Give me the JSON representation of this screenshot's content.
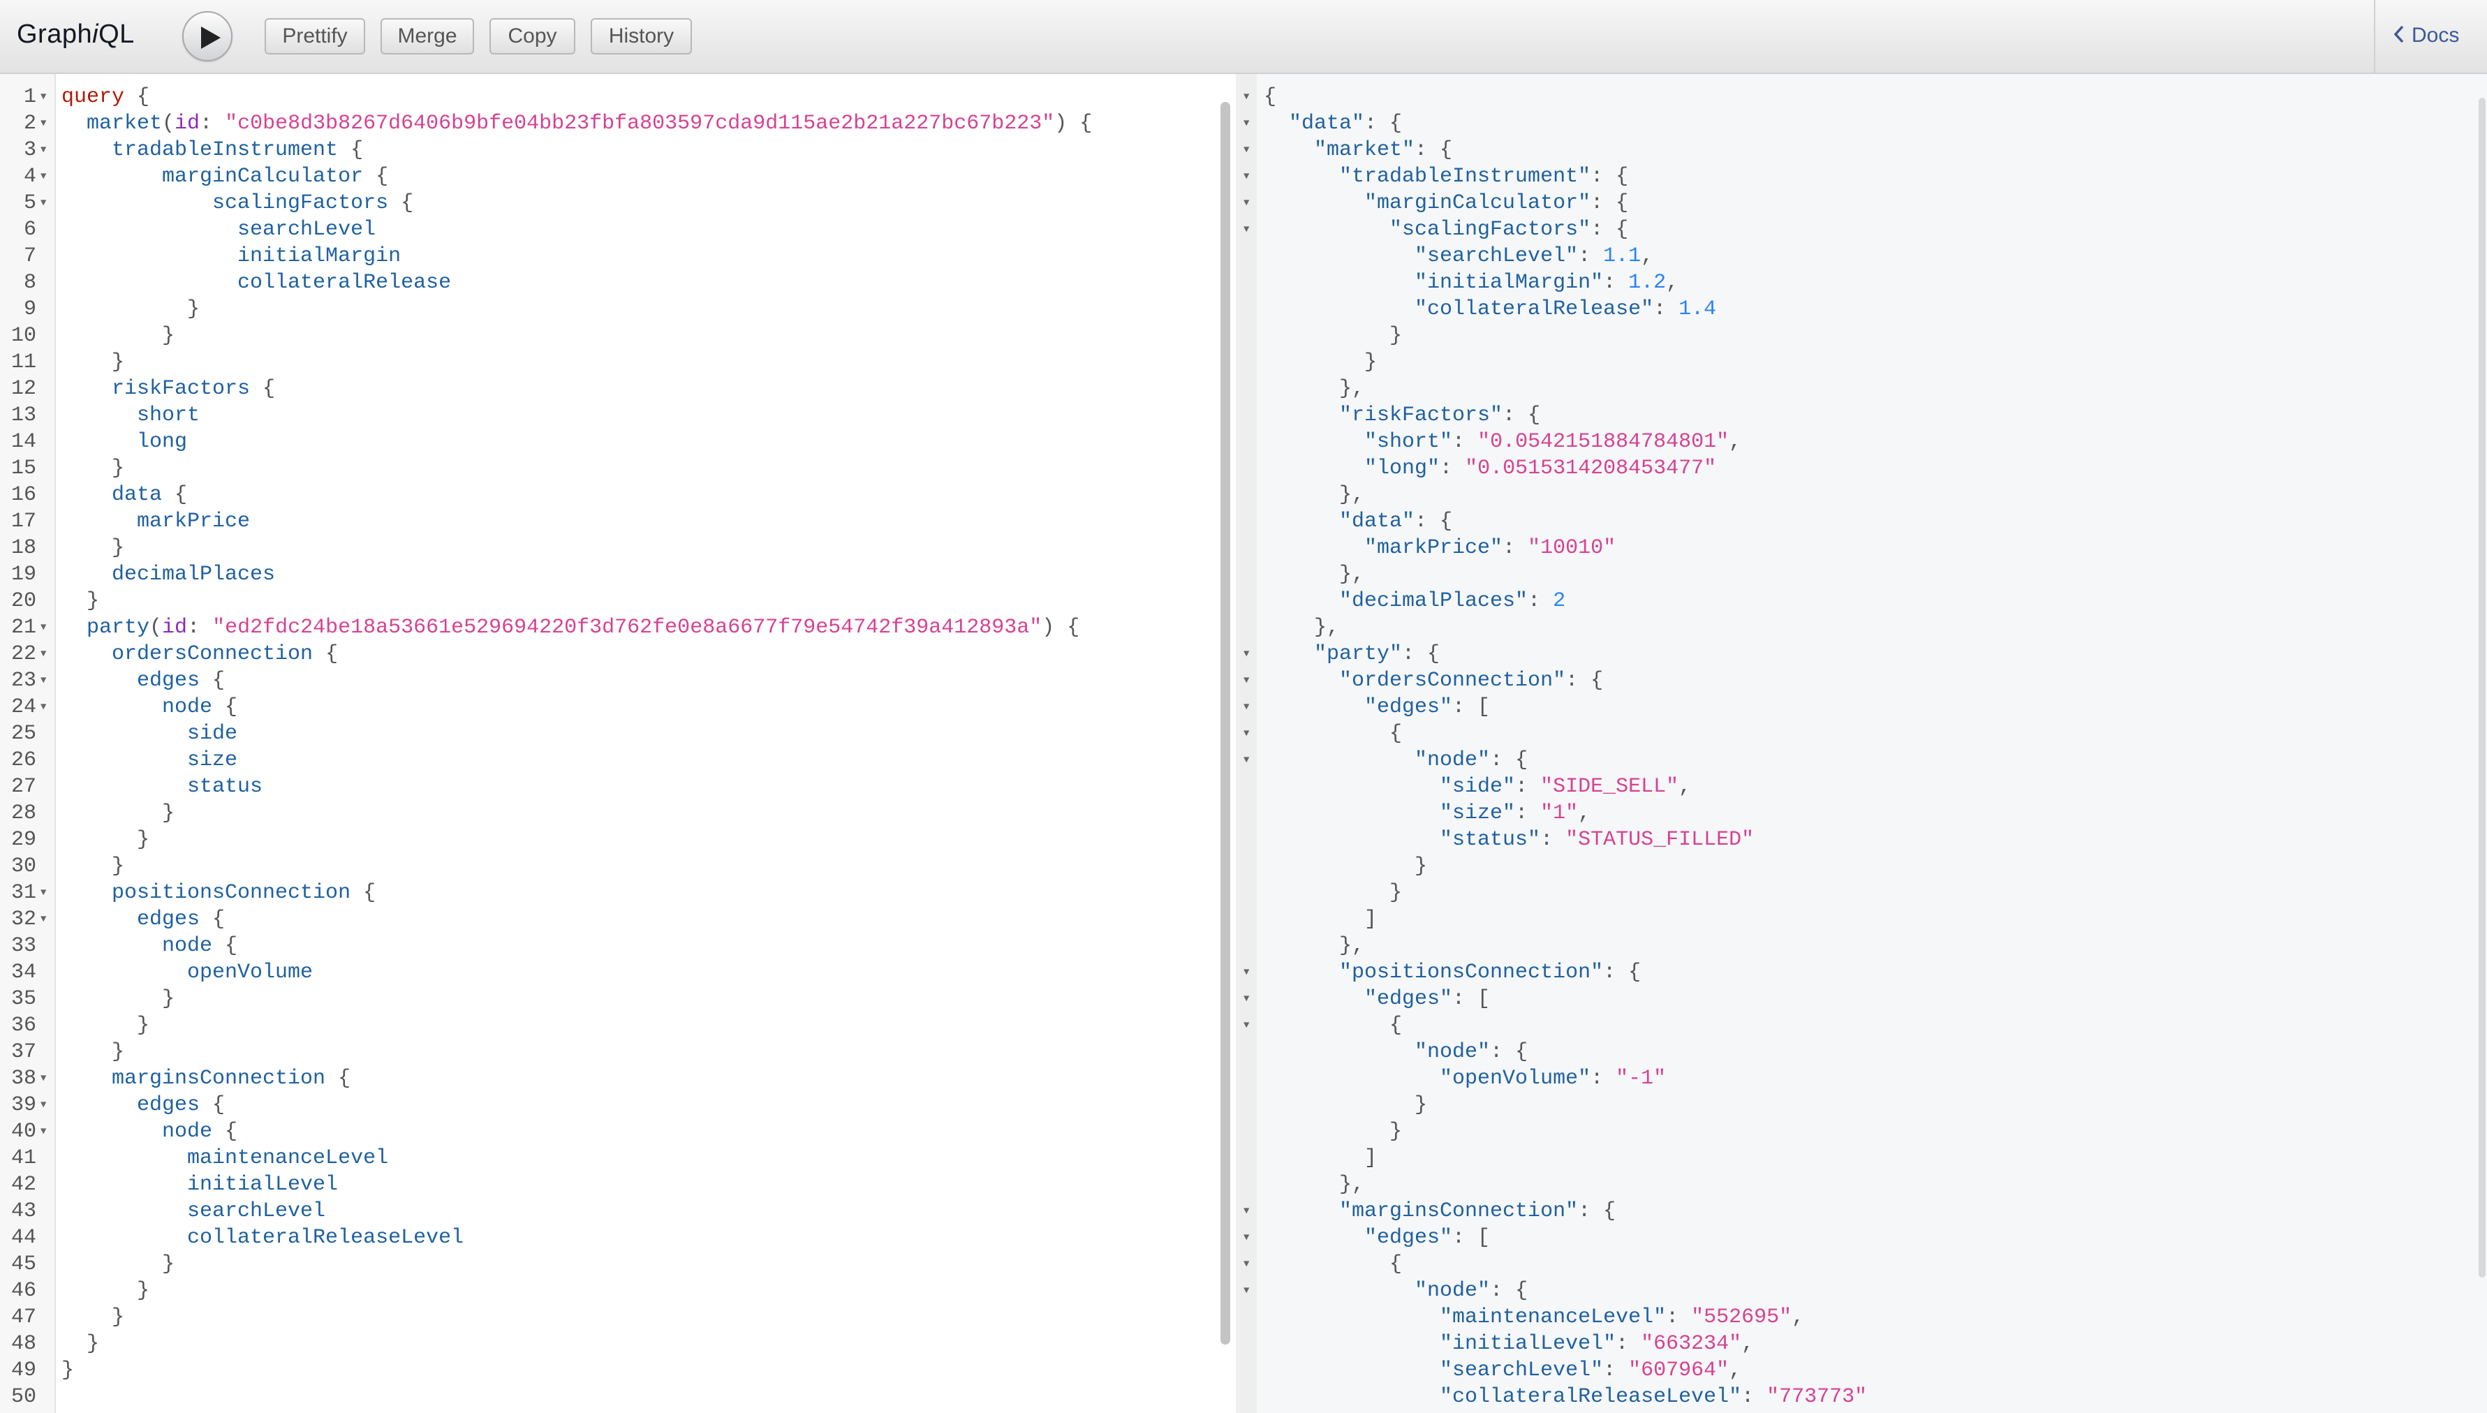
{
  "toolbar": {
    "logo_a": "Graph",
    "logo_b": "i",
    "logo_c": "QL",
    "prettify": "Prettify",
    "merge": "Merge",
    "copy": "Copy",
    "history": "History",
    "docs": "Docs"
  },
  "query_lines": [
    [
      [
        "kw",
        "query"
      ],
      [
        "punct",
        " {"
      ]
    ],
    [
      [
        "prop",
        "  market"
      ],
      [
        "punct",
        "("
      ],
      [
        "attr",
        "id"
      ],
      [
        "punct",
        ": "
      ],
      [
        "str",
        "\"c0be8d3b8267d6406b9bfe04bb23fbfa803597cda9d115ae2b21a227bc67b223\""
      ],
      [
        "punct",
        ") {"
      ]
    ],
    [
      [
        "prop",
        "    tradableInstrument"
      ],
      [
        "punct",
        " {"
      ]
    ],
    [
      [
        "prop",
        "        marginCalculator"
      ],
      [
        "punct",
        " {"
      ]
    ],
    [
      [
        "prop",
        "            scalingFactors"
      ],
      [
        "punct",
        " {"
      ]
    ],
    [
      [
        "prop",
        "              searchLevel"
      ]
    ],
    [
      [
        "prop",
        "              initialMargin"
      ]
    ],
    [
      [
        "prop",
        "              collateralRelease"
      ]
    ],
    [
      [
        "punct",
        "          }"
      ]
    ],
    [
      [
        "punct",
        "        }"
      ]
    ],
    [
      [
        "punct",
        "    }"
      ]
    ],
    [
      [
        "prop",
        "    riskFactors"
      ],
      [
        "punct",
        " {"
      ]
    ],
    [
      [
        "prop",
        "      short"
      ]
    ],
    [
      [
        "prop",
        "      long"
      ]
    ],
    [
      [
        "punct",
        "    }"
      ]
    ],
    [
      [
        "prop",
        "    data"
      ],
      [
        "punct",
        " {"
      ]
    ],
    [
      [
        "prop",
        "      markPrice"
      ]
    ],
    [
      [
        "punct",
        "    }"
      ]
    ],
    [
      [
        "prop",
        "    decimalPlaces"
      ]
    ],
    [
      [
        "punct",
        "  }"
      ]
    ],
    [
      [
        "prop",
        "  party"
      ],
      [
        "punct",
        "("
      ],
      [
        "attr",
        "id"
      ],
      [
        "punct",
        ": "
      ],
      [
        "str",
        "\"ed2fdc24be18a53661e529694220f3d762fe0e8a6677f79e54742f39a412893a\""
      ],
      [
        "punct",
        ") {"
      ]
    ],
    [
      [
        "prop",
        "    ordersConnection"
      ],
      [
        "punct",
        " {"
      ]
    ],
    [
      [
        "prop",
        "      edges"
      ],
      [
        "punct",
        " {"
      ]
    ],
    [
      [
        "prop",
        "        node"
      ],
      [
        "punct",
        " {"
      ]
    ],
    [
      [
        "prop",
        "          side"
      ]
    ],
    [
      [
        "prop",
        "          size"
      ]
    ],
    [
      [
        "prop",
        "          status"
      ]
    ],
    [
      [
        "punct",
        "        }"
      ]
    ],
    [
      [
        "punct",
        "      }"
      ]
    ],
    [
      [
        "punct",
        "    }"
      ]
    ],
    [
      [
        "prop",
        "    positionsConnection"
      ],
      [
        "punct",
        " {"
      ]
    ],
    [
      [
        "prop",
        "      edges"
      ],
      [
        "punct",
        " {"
      ]
    ],
    [
      [
        "prop",
        "        node"
      ],
      [
        "punct",
        " {"
      ]
    ],
    [
      [
        "prop",
        "          openVolume"
      ]
    ],
    [
      [
        "punct",
        "        }"
      ]
    ],
    [
      [
        "punct",
        "      }"
      ]
    ],
    [
      [
        "punct",
        "    }"
      ]
    ],
    [
      [
        "prop",
        "    marginsConnection"
      ],
      [
        "punct",
        " {"
      ]
    ],
    [
      [
        "prop",
        "      edges"
      ],
      [
        "punct",
        " {"
      ]
    ],
    [
      [
        "prop",
        "        node"
      ],
      [
        "punct",
        " {"
      ]
    ],
    [
      [
        "prop",
        "          maintenanceLevel"
      ]
    ],
    [
      [
        "prop",
        "          initialLevel"
      ]
    ],
    [
      [
        "prop",
        "          searchLevel"
      ]
    ],
    [
      [
        "prop",
        "          collateralReleaseLevel"
      ]
    ],
    [
      [
        "punct",
        "        }"
      ]
    ],
    [
      [
        "punct",
        "      }"
      ]
    ],
    [
      [
        "punct",
        "    }"
      ]
    ],
    [
      [
        "punct",
        "  }"
      ]
    ],
    [
      [
        "punct",
        "}"
      ]
    ],
    []
  ],
  "query_folds": [
    1,
    2,
    3,
    4,
    5,
    21,
    22,
    23,
    24,
    31,
    32,
    38,
    39,
    40
  ],
  "result_lines": [
    [
      [
        "punct",
        "{"
      ]
    ],
    [
      [
        "jkey",
        "  \"data\""
      ],
      [
        "punct",
        ": {"
      ]
    ],
    [
      [
        "jkey",
        "    \"market\""
      ],
      [
        "punct",
        ": {"
      ]
    ],
    [
      [
        "jkey",
        "      \"tradableInstrument\""
      ],
      [
        "punct",
        ": {"
      ]
    ],
    [
      [
        "jkey",
        "        \"marginCalculator\""
      ],
      [
        "punct",
        ": {"
      ]
    ],
    [
      [
        "jkey",
        "          \"scalingFactors\""
      ],
      [
        "punct",
        ": {"
      ]
    ],
    [
      [
        "jkey",
        "            \"searchLevel\""
      ],
      [
        "punct",
        ": "
      ],
      [
        "num",
        "1.1"
      ],
      [
        "punct",
        ","
      ]
    ],
    [
      [
        "jkey",
        "            \"initialMargin\""
      ],
      [
        "punct",
        ": "
      ],
      [
        "num",
        "1.2"
      ],
      [
        "punct",
        ","
      ]
    ],
    [
      [
        "jkey",
        "            \"collateralRelease\""
      ],
      [
        "punct",
        ": "
      ],
      [
        "num",
        "1.4"
      ]
    ],
    [
      [
        "punct",
        "          }"
      ]
    ],
    [
      [
        "punct",
        "        }"
      ]
    ],
    [
      [
        "punct",
        "      },"
      ]
    ],
    [
      [
        "jkey",
        "      \"riskFactors\""
      ],
      [
        "punct",
        ": {"
      ]
    ],
    [
      [
        "jkey",
        "        \"short\""
      ],
      [
        "punct",
        ": "
      ],
      [
        "str",
        "\"0.0542151884784801\""
      ],
      [
        "punct",
        ","
      ]
    ],
    [
      [
        "jkey",
        "        \"long\""
      ],
      [
        "punct",
        ": "
      ],
      [
        "str",
        "\"0.0515314208453477\""
      ]
    ],
    [
      [
        "punct",
        "      },"
      ]
    ],
    [
      [
        "jkey",
        "      \"data\""
      ],
      [
        "punct",
        ": {"
      ]
    ],
    [
      [
        "jkey",
        "        \"markPrice\""
      ],
      [
        "punct",
        ": "
      ],
      [
        "str",
        "\"10010\""
      ]
    ],
    [
      [
        "punct",
        "      },"
      ]
    ],
    [
      [
        "jkey",
        "      \"decimalPlaces\""
      ],
      [
        "punct",
        ": "
      ],
      [
        "num",
        "2"
      ]
    ],
    [
      [
        "punct",
        "    },"
      ]
    ],
    [
      [
        "jkey",
        "    \"party\""
      ],
      [
        "punct",
        ": {"
      ]
    ],
    [
      [
        "jkey",
        "      \"ordersConnection\""
      ],
      [
        "punct",
        ": {"
      ]
    ],
    [
      [
        "jkey",
        "        \"edges\""
      ],
      [
        "punct",
        ": ["
      ]
    ],
    [
      [
        "punct",
        "          {"
      ]
    ],
    [
      [
        "jkey",
        "            \"node\""
      ],
      [
        "punct",
        ": {"
      ]
    ],
    [
      [
        "jkey",
        "              \"side\""
      ],
      [
        "punct",
        ": "
      ],
      [
        "str",
        "\"SIDE_SELL\""
      ],
      [
        "punct",
        ","
      ]
    ],
    [
      [
        "jkey",
        "              \"size\""
      ],
      [
        "punct",
        ": "
      ],
      [
        "str",
        "\"1\""
      ],
      [
        "punct",
        ","
      ]
    ],
    [
      [
        "jkey",
        "              \"status\""
      ],
      [
        "punct",
        ": "
      ],
      [
        "str",
        "\"STATUS_FILLED\""
      ]
    ],
    [
      [
        "punct",
        "            }"
      ]
    ],
    [
      [
        "punct",
        "          }"
      ]
    ],
    [
      [
        "punct",
        "        ]"
      ]
    ],
    [
      [
        "punct",
        "      },"
      ]
    ],
    [
      [
        "jkey",
        "      \"positionsConnection\""
      ],
      [
        "punct",
        ": {"
      ]
    ],
    [
      [
        "jkey",
        "        \"edges\""
      ],
      [
        "punct",
        ": ["
      ]
    ],
    [
      [
        "punct",
        "          {"
      ]
    ],
    [
      [
        "jkey",
        "            \"node\""
      ],
      [
        "punct",
        ": {"
      ]
    ],
    [
      [
        "jkey",
        "              \"openVolume\""
      ],
      [
        "punct",
        ": "
      ],
      [
        "str",
        "\"-1\""
      ]
    ],
    [
      [
        "punct",
        "            }"
      ]
    ],
    [
      [
        "punct",
        "          }"
      ]
    ],
    [
      [
        "punct",
        "        ]"
      ]
    ],
    [
      [
        "punct",
        "      },"
      ]
    ],
    [
      [
        "jkey",
        "      \"marginsConnection\""
      ],
      [
        "punct",
        ": {"
      ]
    ],
    [
      [
        "jkey",
        "        \"edges\""
      ],
      [
        "punct",
        ": ["
      ]
    ],
    [
      [
        "punct",
        "          {"
      ]
    ],
    [
      [
        "jkey",
        "            \"node\""
      ],
      [
        "punct",
        ": {"
      ]
    ],
    [
      [
        "jkey",
        "              \"maintenanceLevel\""
      ],
      [
        "punct",
        ": "
      ],
      [
        "str",
        "\"552695\""
      ],
      [
        "punct",
        ","
      ]
    ],
    [
      [
        "jkey",
        "              \"initialLevel\""
      ],
      [
        "punct",
        ": "
      ],
      [
        "str",
        "\"663234\""
      ],
      [
        "punct",
        ","
      ]
    ],
    [
      [
        "jkey",
        "              \"searchLevel\""
      ],
      [
        "punct",
        ": "
      ],
      [
        "str",
        "\"607964\""
      ],
      [
        "punct",
        ","
      ]
    ],
    [
      [
        "jkey",
        "              \"collateralReleaseLevel\""
      ],
      [
        "punct",
        ": "
      ],
      [
        "str",
        "\"773773\""
      ]
    ]
  ],
  "result_folds": [
    1,
    2,
    3,
    4,
    5,
    6,
    22,
    23,
    24,
    25,
    26,
    34,
    35,
    36,
    43,
    44,
    45,
    46
  ]
}
